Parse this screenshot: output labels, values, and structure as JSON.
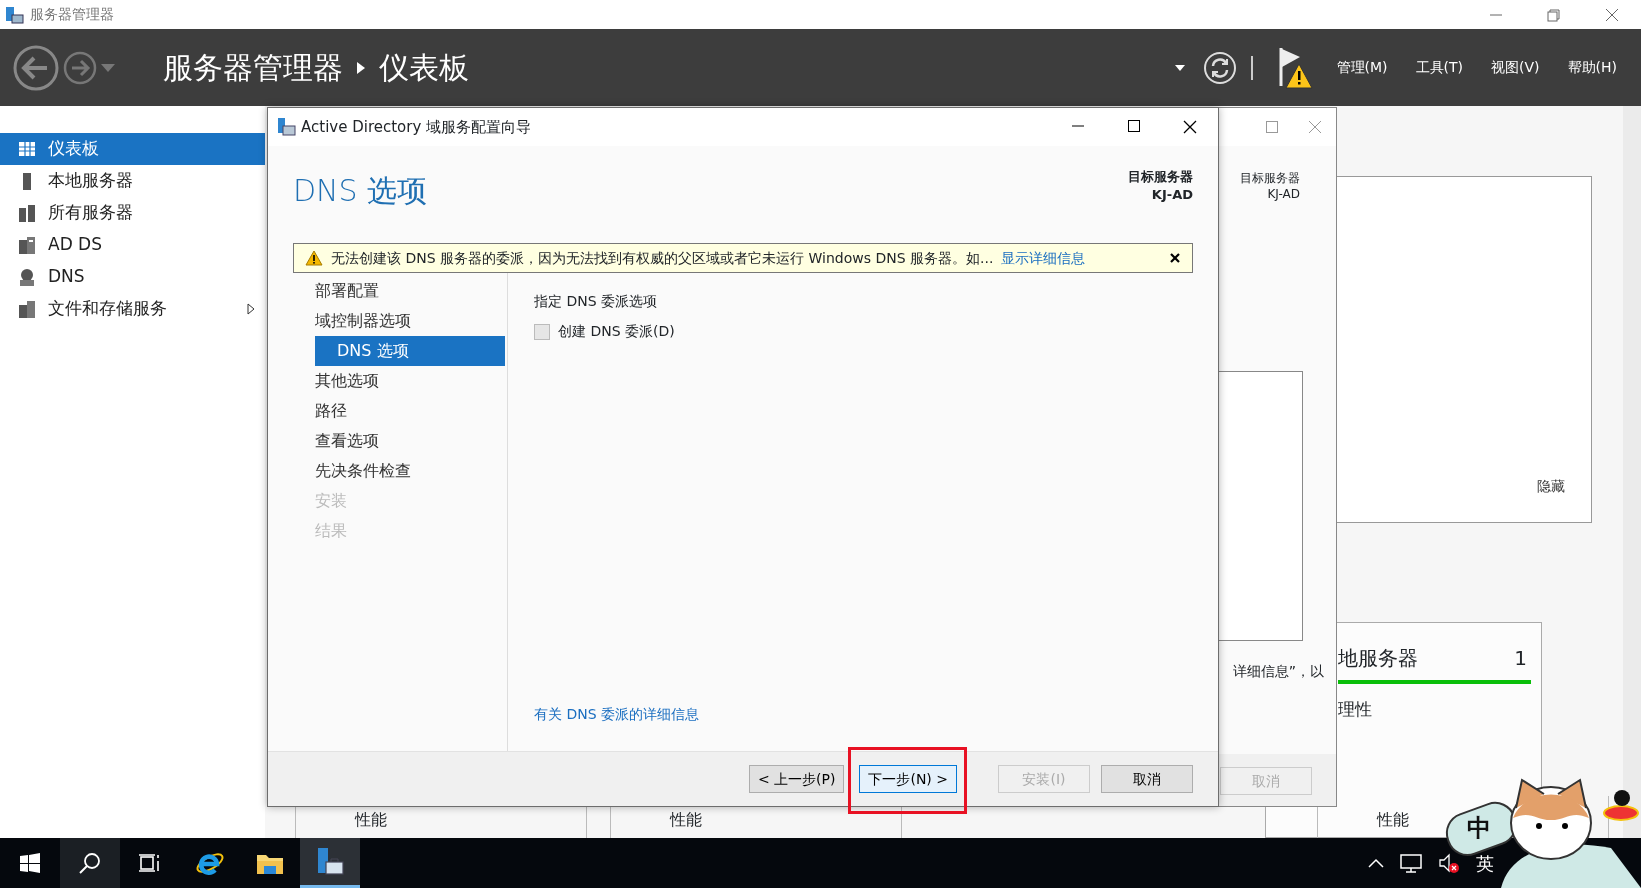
{
  "app": {
    "title": "服务器管理器"
  },
  "header": {
    "breadcrumb": [
      "服务器管理器",
      "仪表板"
    ],
    "menus": [
      "管理(M)",
      "工具(T)",
      "视图(V)",
      "帮助(H)"
    ]
  },
  "sidebar": {
    "items": [
      {
        "label": "仪表板",
        "selected": true,
        "expandable": false
      },
      {
        "label": "本地服务器",
        "selected": false,
        "expandable": false
      },
      {
        "label": "所有服务器",
        "selected": false,
        "expandable": false
      },
      {
        "label": "AD DS",
        "selected": false,
        "expandable": false
      },
      {
        "label": "DNS",
        "selected": false,
        "expandable": false
      },
      {
        "label": "文件和存储服务",
        "selected": false,
        "expandable": true
      }
    ]
  },
  "dashboard": {
    "hide_link": "隐藏",
    "tile_title": "地服务器",
    "tile_count": "1",
    "tile_row": "理性",
    "column_labels": [
      "性能",
      "性能",
      "性能"
    ]
  },
  "background_window": {
    "target_label": "目标服务器",
    "target_server": "KJ-AD",
    "text": "详细信息”，以",
    "cancel": "取消"
  },
  "wizard": {
    "title": "Active Directory 域服务配置向导",
    "page_title": "DNS 选项",
    "target_label": "目标服务器",
    "target_server": "KJ-AD",
    "warning": {
      "text": "无法创建该 DNS 服务器的委派，因为无法找到有权威的父区域或者它未运行 Windows DNS 服务器。如...",
      "link": "显示详细信息"
    },
    "steps": [
      {
        "label": "部署配置",
        "selected": false,
        "disabled": false
      },
      {
        "label": "域控制器选项",
        "selected": false,
        "disabled": false
      },
      {
        "label": "DNS 选项",
        "selected": true,
        "disabled": false
      },
      {
        "label": "其他选项",
        "selected": false,
        "disabled": false
      },
      {
        "label": "路径",
        "selected": false,
        "disabled": false
      },
      {
        "label": "查看选项",
        "selected": false,
        "disabled": false
      },
      {
        "label": "先决条件检查",
        "selected": false,
        "disabled": false
      },
      {
        "label": "安装",
        "selected": false,
        "disabled": true
      },
      {
        "label": "结果",
        "selected": false,
        "disabled": true
      }
    ],
    "section_label": "指定 DNS 委派选项",
    "checkbox": {
      "label": "创建 DNS 委派(D)",
      "checked": false
    },
    "help_link": "有关 DNS 委派的详细信息",
    "buttons": [
      {
        "label": "< 上一步(P)",
        "disabled": false,
        "focused": false,
        "highlighted": false
      },
      {
        "label": "下一步(N) >",
        "disabled": false,
        "focused": true,
        "highlighted": true
      },
      {
        "label": "安装(I)",
        "disabled": true,
        "focused": false,
        "highlighted": false
      },
      {
        "label": "取消",
        "disabled": false,
        "focused": false,
        "highlighted": false
      }
    ]
  },
  "taskbar": {
    "ime": "英"
  },
  "sticker": {
    "label": "中"
  }
}
